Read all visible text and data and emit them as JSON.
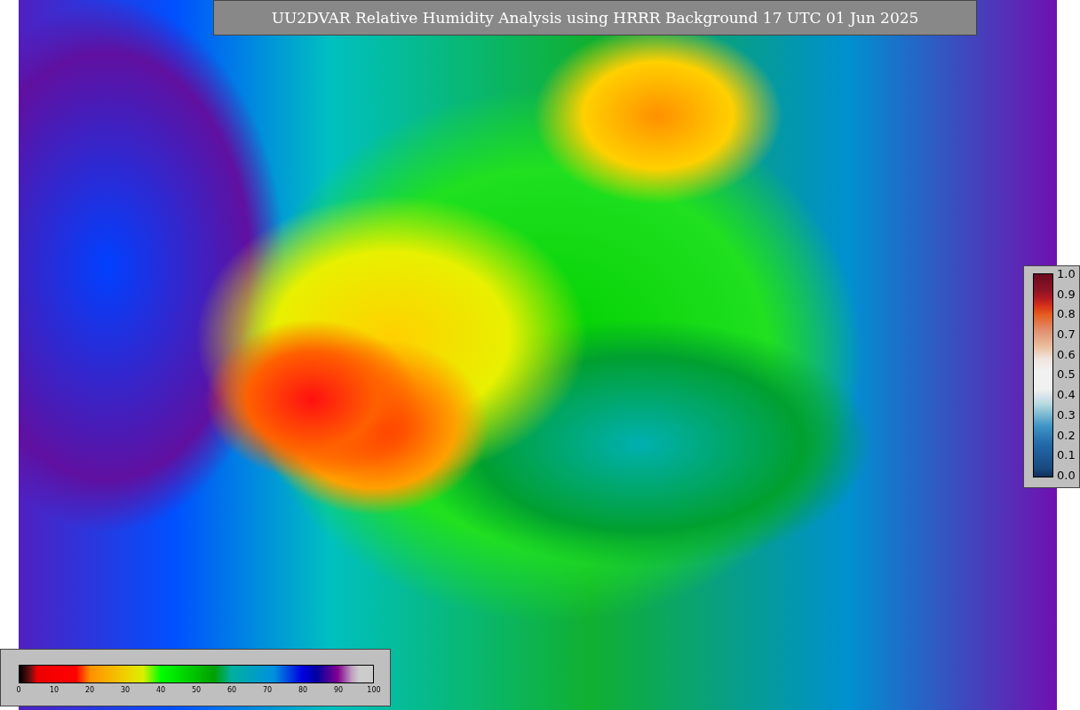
{
  "title": "UU2DVAR Relative Humidity Analysis using HRRR Background 17 UTC 01 Jun 2025",
  "ratio_colorbar": {
    "ticks": [
      "1.0",
      "0.9",
      "0.8",
      "0.7",
      "0.6",
      "0.5",
      "0.4",
      "0.3",
      "0.2",
      "0.1",
      "0.0"
    ]
  },
  "humidity_colorbar": {
    "ticks": [
      "0",
      "10",
      "20",
      "30",
      "40",
      "50",
      "60",
      "70",
      "80",
      "90",
      "100"
    ]
  }
}
